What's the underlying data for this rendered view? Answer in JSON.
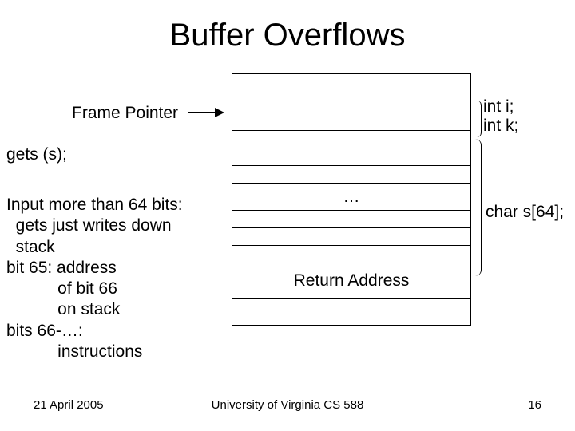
{
  "title": "Buffer Overflows",
  "frame_pointer_label": "Frame Pointer",
  "gets_line": "gets (s);",
  "notes_text": "Input more than 64 bits:\n  gets just writes down\n  stack\nbit 65: address\n           of bit 66\n           on stack\nbits 66-…:\n           instructions",
  "stack": {
    "dots": "…",
    "return_address": "Return Address"
  },
  "right_labels": {
    "vars": "int i;\nint k;",
    "s": "char s[64];"
  },
  "footer": {
    "date": "21 April 2005",
    "center": "University of Virginia CS 588",
    "page": "16"
  }
}
